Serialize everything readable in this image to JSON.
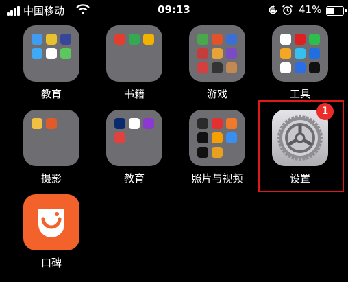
{
  "status_bar": {
    "carrier": "中国移动",
    "time": "09:13",
    "battery_percent": "41%",
    "battery_level": 0.41
  },
  "apps": [
    {
      "label": "教育"
    },
    {
      "label": "书籍"
    },
    {
      "label": "游戏"
    },
    {
      "label": "工具"
    },
    {
      "label": "摄影"
    },
    {
      "label": "教育"
    },
    {
      "label": "照片与视频"
    },
    {
      "label": "设置",
      "badge": "1",
      "highlighted": true
    },
    {
      "label": "口碑"
    }
  ],
  "colors": {
    "background": "#000000",
    "folder": "#6e6e72",
    "badge": "#ec2b2b",
    "highlight": "#e01818",
    "koubei": "#f3622a"
  },
  "mini_icon_colors": {
    "jiaoyu_1": [
      "#3f9cf0",
      "#e8c22e",
      "#38469a",
      "#3fa9f5",
      "#ffffff",
      "#5cc75c"
    ],
    "shuji": [
      "#e43d2f",
      "#34a853",
      "#f2b300"
    ],
    "youxi": [
      "#4aa84c",
      "#e0532b",
      "#3b6fd6",
      "#c63b3b",
      "#e5a33a",
      "#7a4bc4",
      "#d44040",
      "#333333",
      "#c28a52"
    ],
    "gongju": [
      "#ffffff",
      "#e02020",
      "#2dbf4e",
      "#f5a623",
      "#36c0f0",
      "#1f6fe0",
      "#ffffff",
      "#2a6fe8",
      "#111111"
    ],
    "sheying": [
      "#f0c040",
      "#e05a2a"
    ],
    "jiaoyu_2": [
      "#0a2a6e",
      "#ffffff",
      "#8a3ad0",
      "#e34040"
    ],
    "zhaopian": [
      "#2b2b2b",
      "#e43030",
      "#f07a2a",
      "#111111",
      "#f5a000",
      "#3a8ef0",
      "#111111",
      "#e8a020"
    ]
  }
}
